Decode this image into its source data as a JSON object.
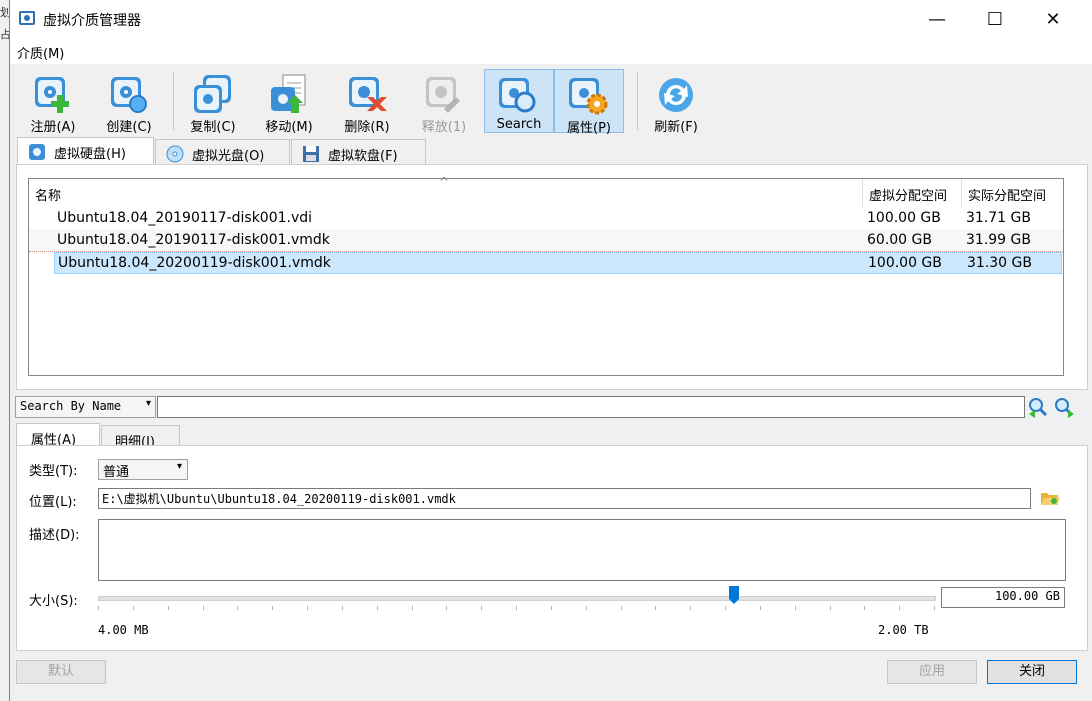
{
  "behind_window": {
    "chars": [
      "划",
      "占"
    ]
  },
  "window": {
    "title": "虚拟介质管理器",
    "minimize": "—",
    "maximize": "☐",
    "close": "✕"
  },
  "menu": {
    "media": "介质(M)"
  },
  "toolbar": {
    "register": "注册(A)",
    "create": "创建(C)",
    "copy": "复制(C)",
    "move": "移动(M)",
    "delete": "删除(R)",
    "release": "释放(1)",
    "search": "Search",
    "properties": "属性(P)",
    "refresh": "刷新(F)"
  },
  "tabs": {
    "hard_disk": "虚拟硬盘(H)",
    "optical": "虚拟光盘(O)",
    "floppy": "虚拟软盘(F)"
  },
  "list": {
    "sort_indicator": "^",
    "columns": {
      "name": "名称",
      "virtual_size": "虚拟分配空间",
      "actual_size": "实际分配空间"
    },
    "rows": [
      {
        "name": "Ubuntu18.04_20190117-disk001.vdi",
        "virtual_size": "100.00 GB",
        "actual_size": "31.71 GB"
      },
      {
        "name": "Ubuntu18.04_20190117-disk001.vmdk",
        "virtual_size": "60.00 GB",
        "actual_size": "31.99 GB"
      },
      {
        "name": "Ubuntu18.04_20200119-disk001.vmdk",
        "virtual_size": "100.00 GB",
        "actual_size": "31.30 GB"
      }
    ],
    "selected_index": 2
  },
  "search": {
    "mode": "Search By Name",
    "value": "",
    "dropdown_arrow": "▾"
  },
  "detail_tabs": {
    "attributes": "属性(A)",
    "details": "明细(I)"
  },
  "properties": {
    "type_label": "类型(T):",
    "type_value": "普通",
    "location_label": "位置(L):",
    "location_value": "E:\\虚拟机\\Ubuntu\\Ubuntu18.04_20200119-disk001.vmdk",
    "description_label": "描述(D):",
    "description_value": "",
    "size_label": "大小(S):",
    "size_value": "100.00 GB",
    "size_min": "4.00 MB",
    "size_max": "2.00 TB"
  },
  "buttons": {
    "reset": "默认",
    "apply": "应用",
    "close": "关闭"
  },
  "colors": {
    "selection": "#cce8ff",
    "selection_border": "#99d1ff",
    "accent": "#0078d7"
  }
}
